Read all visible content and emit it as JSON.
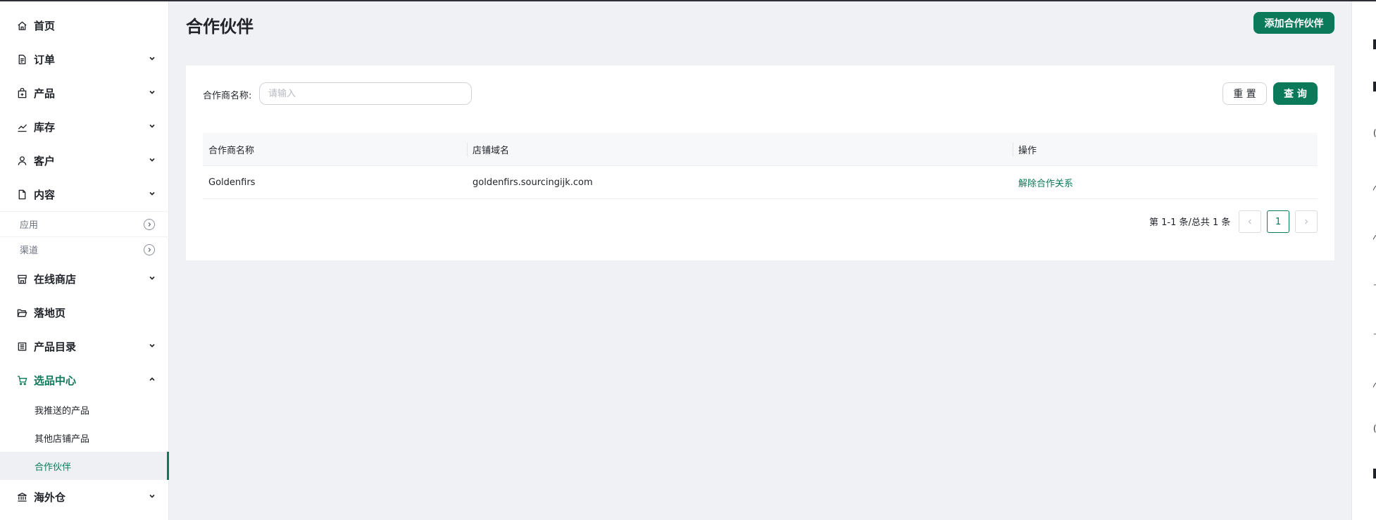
{
  "sidebar": {
    "items": [
      {
        "label": "首页"
      },
      {
        "label": "订单"
      },
      {
        "label": "产品"
      },
      {
        "label": "库存"
      },
      {
        "label": "客户"
      },
      {
        "label": "内容"
      }
    ],
    "groups": [
      {
        "label": "应用"
      },
      {
        "label": "渠道"
      }
    ],
    "items2": [
      {
        "label": "在线商店"
      },
      {
        "label": "落地页"
      },
      {
        "label": "产品目录"
      },
      {
        "label": "选品中心"
      }
    ],
    "sub_items": [
      {
        "label": "我推送的产品"
      },
      {
        "label": "其他店铺产品"
      },
      {
        "label": "合作伙伴"
      }
    ],
    "last_item": {
      "label": "海外仓"
    }
  },
  "header": {
    "title": "合作伙伴",
    "add_button": "添加合作伙伴"
  },
  "filter": {
    "label": "合作商名称:",
    "placeholder": "请输入",
    "reset_button": "重 置",
    "query_button": "查 询"
  },
  "table": {
    "columns": [
      "合作商名称",
      "店铺域名",
      "操作"
    ],
    "rows": [
      {
        "name": "Goldenfirs",
        "domain": "goldenfirs.sourcingijk.com",
        "action": "解除合作关系"
      }
    ]
  },
  "pagination": {
    "summary": "第 1-1 条/总共 1 条",
    "current_page": "1",
    "prev": "<",
    "next": ">"
  },
  "colors": {
    "accent": "#0a7a5a",
    "background": "#f0f1f5"
  }
}
